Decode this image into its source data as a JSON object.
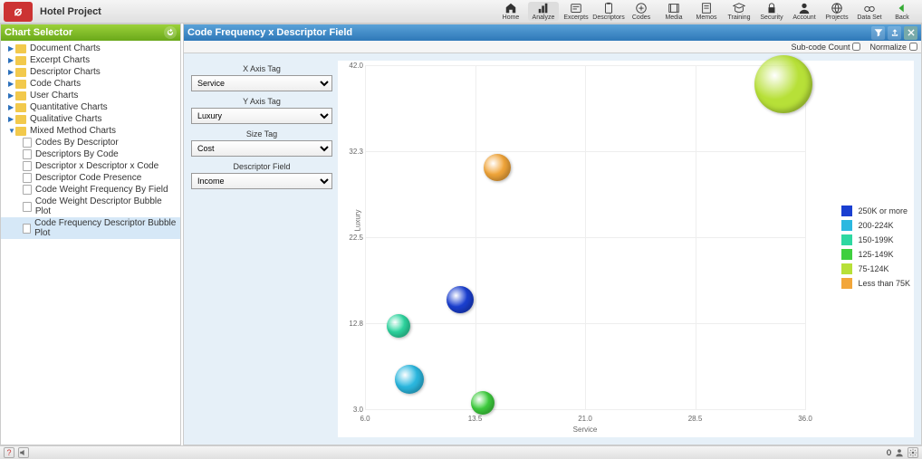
{
  "app": {
    "title": "Hotel Project"
  },
  "nav": [
    {
      "label": "Home",
      "icon": "home"
    },
    {
      "label": "Analyze",
      "icon": "bars",
      "active": true
    },
    {
      "label": "Excerpts",
      "icon": "quote"
    },
    {
      "label": "Descriptors",
      "icon": "clip"
    },
    {
      "label": "Codes",
      "icon": "plus"
    },
    {
      "label": "Media",
      "icon": "film"
    },
    {
      "label": "Memos",
      "icon": "note"
    },
    {
      "label": "Training",
      "icon": "grad"
    },
    {
      "label": "Security",
      "icon": "lock"
    },
    {
      "label": "Account",
      "icon": "user"
    },
    {
      "label": "Projects",
      "icon": "globe"
    },
    {
      "label": "Data Set",
      "icon": "binoc"
    },
    {
      "label": "Back",
      "icon": "back"
    }
  ],
  "sidebar": {
    "title": "Chart Selector",
    "folders": [
      "Document Charts",
      "Excerpt Charts",
      "Descriptor Charts",
      "Code Charts",
      "User Charts",
      "Quantitative Charts",
      "Qualitative Charts"
    ],
    "open_folder": "Mixed Method Charts",
    "children": [
      "Codes By Descriptor",
      "Descriptors By Code",
      "Descriptor x Descriptor x Code",
      "Descriptor Code Presence",
      "Code Weight Frequency By Field",
      "Code Weight Descriptor Bubble Plot",
      "Code Frequency Descriptor Bubble Plot"
    ],
    "selected": "Code Frequency Descriptor Bubble Plot"
  },
  "panel": {
    "title": "Code Frequency x Descriptor Field",
    "subcode_label": "Sub-code Count",
    "normalize_label": "Normalize",
    "subcode_checked": false,
    "normalize_checked": false
  },
  "controls": {
    "x_label": "X Axis Tag",
    "x_value": "Service",
    "y_label": "Y Axis Tag",
    "y_value": "Luxury",
    "size_label": "Size Tag",
    "size_value": "Cost",
    "field_label": "Descriptor Field",
    "field_value": "Income"
  },
  "legend": [
    {
      "label": "250K or more",
      "color": "#1a3fd1"
    },
    {
      "label": "200-224K",
      "color": "#2bb8e0"
    },
    {
      "label": "150-199K",
      "color": "#2ed8a1"
    },
    {
      "label": "125-149K",
      "color": "#3fcf3f"
    },
    {
      "label": "75-124K",
      "color": "#b7e038"
    },
    {
      "label": "Less than 75K",
      "color": "#f2a63a"
    }
  ],
  "chart_data": {
    "type": "scatter",
    "xlabel": "Service",
    "ylabel": "Luxury",
    "xlim": [
      6,
      36
    ],
    "ylim": [
      3,
      42
    ],
    "x_ticks": [
      6.0,
      13.5,
      21.0,
      28.5,
      36.0
    ],
    "y_ticks": [
      3.0,
      12.8,
      22.5,
      32.3,
      42.0
    ],
    "series": [
      {
        "name": "250K or more",
        "color": "#1a3fd1",
        "x": 12.5,
        "y": 15.5,
        "r": 15
      },
      {
        "name": "200-224K",
        "color": "#2bb8e0",
        "x": 9.0,
        "y": 6.5,
        "r": 16
      },
      {
        "name": "150-199K",
        "color": "#2ed8a1",
        "x": 8.3,
        "y": 12.5,
        "r": 13
      },
      {
        "name": "125-149K",
        "color": "#3fcf3f",
        "x": 14.0,
        "y": 3.8,
        "r": 13
      },
      {
        "name": "75-124K",
        "color": "#b7e038",
        "x": 34.5,
        "y": 40.0,
        "r": 32
      },
      {
        "name": "Less than 75K",
        "color": "#f2a63a",
        "x": 15.0,
        "y": 30.5,
        "r": 15
      }
    ]
  },
  "status": {
    "users": "0",
    "sound_icon": "sound"
  }
}
